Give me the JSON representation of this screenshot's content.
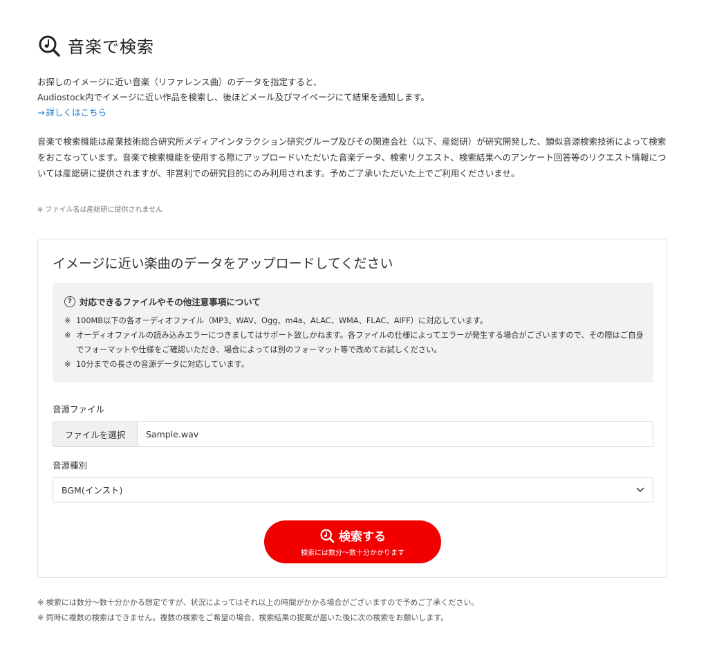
{
  "page": {
    "title": "音楽で検索",
    "title_icon": "music-search-icon"
  },
  "intro": {
    "line1": "お探しのイメージに近い音楽（リファレンス曲）のデータを指定すると、",
    "line2": "Audiostock内でイメージに近い作品を検索し、後ほどメール及びマイページにて結果を通知します。",
    "link_arrow": "→",
    "link_label": "詳しくはこちら"
  },
  "description": {
    "text": "音楽で検索機能は産業技術総合研究所メディアインタラクション研究グループ及びその関連会社（以下、産総研）が研究開発した、類似音源検索技術によって検索をおこなっています。音楽で検索機能を使用する際にアップロードいただいた音楽データ、検索リクエスト、検索結果へのアンケート回答等のリクエスト情報については産総研に提供されますが、非営利での研究目的にのみ利用されます。予めご了承いただいた上でご利用くださいませ。",
    "note": "※ ファイル名は産総研に提供されません"
  },
  "upload": {
    "heading": "イメージに近い楽曲のデータをアップロードしてください",
    "info_icon": "question-circle-icon",
    "info_icon_glyph": "?",
    "info_title": "対応できるファイルやその他注意事項について",
    "info_items": [
      {
        "mark": "※",
        "text": "100MB以下の各オーディオファイル（MP3、WAV、Ogg、m4a、ALAC、WMA、FLAC、AIFF）に対応しています。"
      },
      {
        "mark": "※",
        "text": "オーディオファイルの読み込みエラーにつきましてはサポート致しかねます。各ファイルの仕様によってエラーが発生する場合がございますので、その際はご自身でフォーマットや仕様をご確認いただき、場合によっては別のフォーマット等で改めてお試しください。"
      },
      {
        "mark": "※",
        "text": "10分までの長さの音源データに対応しています。"
      }
    ],
    "file_label": "音源ファイル",
    "file_button": "ファイルを選択",
    "file_value": "Sample.wav",
    "type_label": "音源種別",
    "type_selected": "BGM(インスト)",
    "type_icon": "chevron-down-icon",
    "search_label": "検索する",
    "search_sub": "検索には数分〜数十分かかります",
    "search_icon": "music-search-icon"
  },
  "footer_notes": [
    "※ 検索には数分〜数十分かかる想定ですが、状況によってはそれ以上の時間がかかる場合がございますので予めご了承ください。",
    "※ 同時に複数の検索はできません。複数の検索をご希望の場合、検索結果の提案が届いた後に次の検索をお願いします。"
  ],
  "colors": {
    "accent_red": "#f20000",
    "link_blue": "#1a73c9",
    "info_bg": "#f2f2f2"
  }
}
